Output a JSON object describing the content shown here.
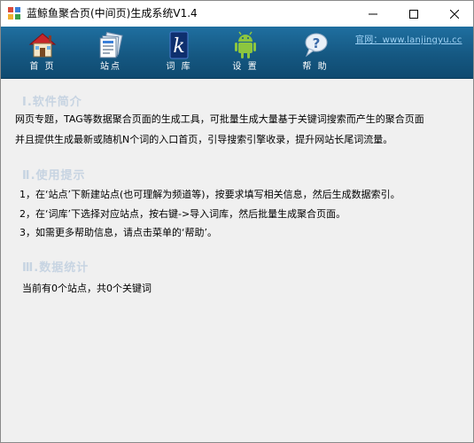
{
  "window": {
    "title": "蓝鲸鱼聚合页(中间页)生成系统V1.4",
    "controls": {
      "minimize": "minimize",
      "maximize": "maximize",
      "close": "close"
    }
  },
  "toolbar": {
    "items": [
      {
        "label": "首 页",
        "icon": "home-icon"
      },
      {
        "label": "站点",
        "icon": "site-icon"
      },
      {
        "label": "词 库",
        "icon": "wordlib-icon"
      },
      {
        "label": "设 置",
        "icon": "android-settings-icon"
      },
      {
        "label": "帮 助",
        "icon": "help-icon"
      }
    ],
    "site_link": "官网：www.lanjingyu.cc",
    "colors": {
      "bar": "#155882",
      "link": "#9fd2f5"
    }
  },
  "sections": [
    {
      "title": "Ⅰ.软件简介",
      "lines": [
        "网页专题，TAG等数据聚合页面的生成工具，可批量生成大量基于关键词搜索而产生的聚合页面",
        "并且提供生成最新或随机N个词的入口首页，引导搜索引擎收录，提升网站长尾词流量。"
      ]
    },
    {
      "title": "Ⅱ.使用提示",
      "lines": [
        "1，在‘站点’下新建站点(也可理解为频道等)，按要求填写相关信息，然后生成数据索引。",
        "2，在‘词库’下选择对应站点，按右键->导入词库，然后批量生成聚合页面。",
        "3，如需更多帮助信息，请点击菜单的‘帮助’。"
      ]
    },
    {
      "title": "Ⅲ.数据统计",
      "lines": [
        "当前有0个站点，共0个关键词"
      ]
    }
  ]
}
